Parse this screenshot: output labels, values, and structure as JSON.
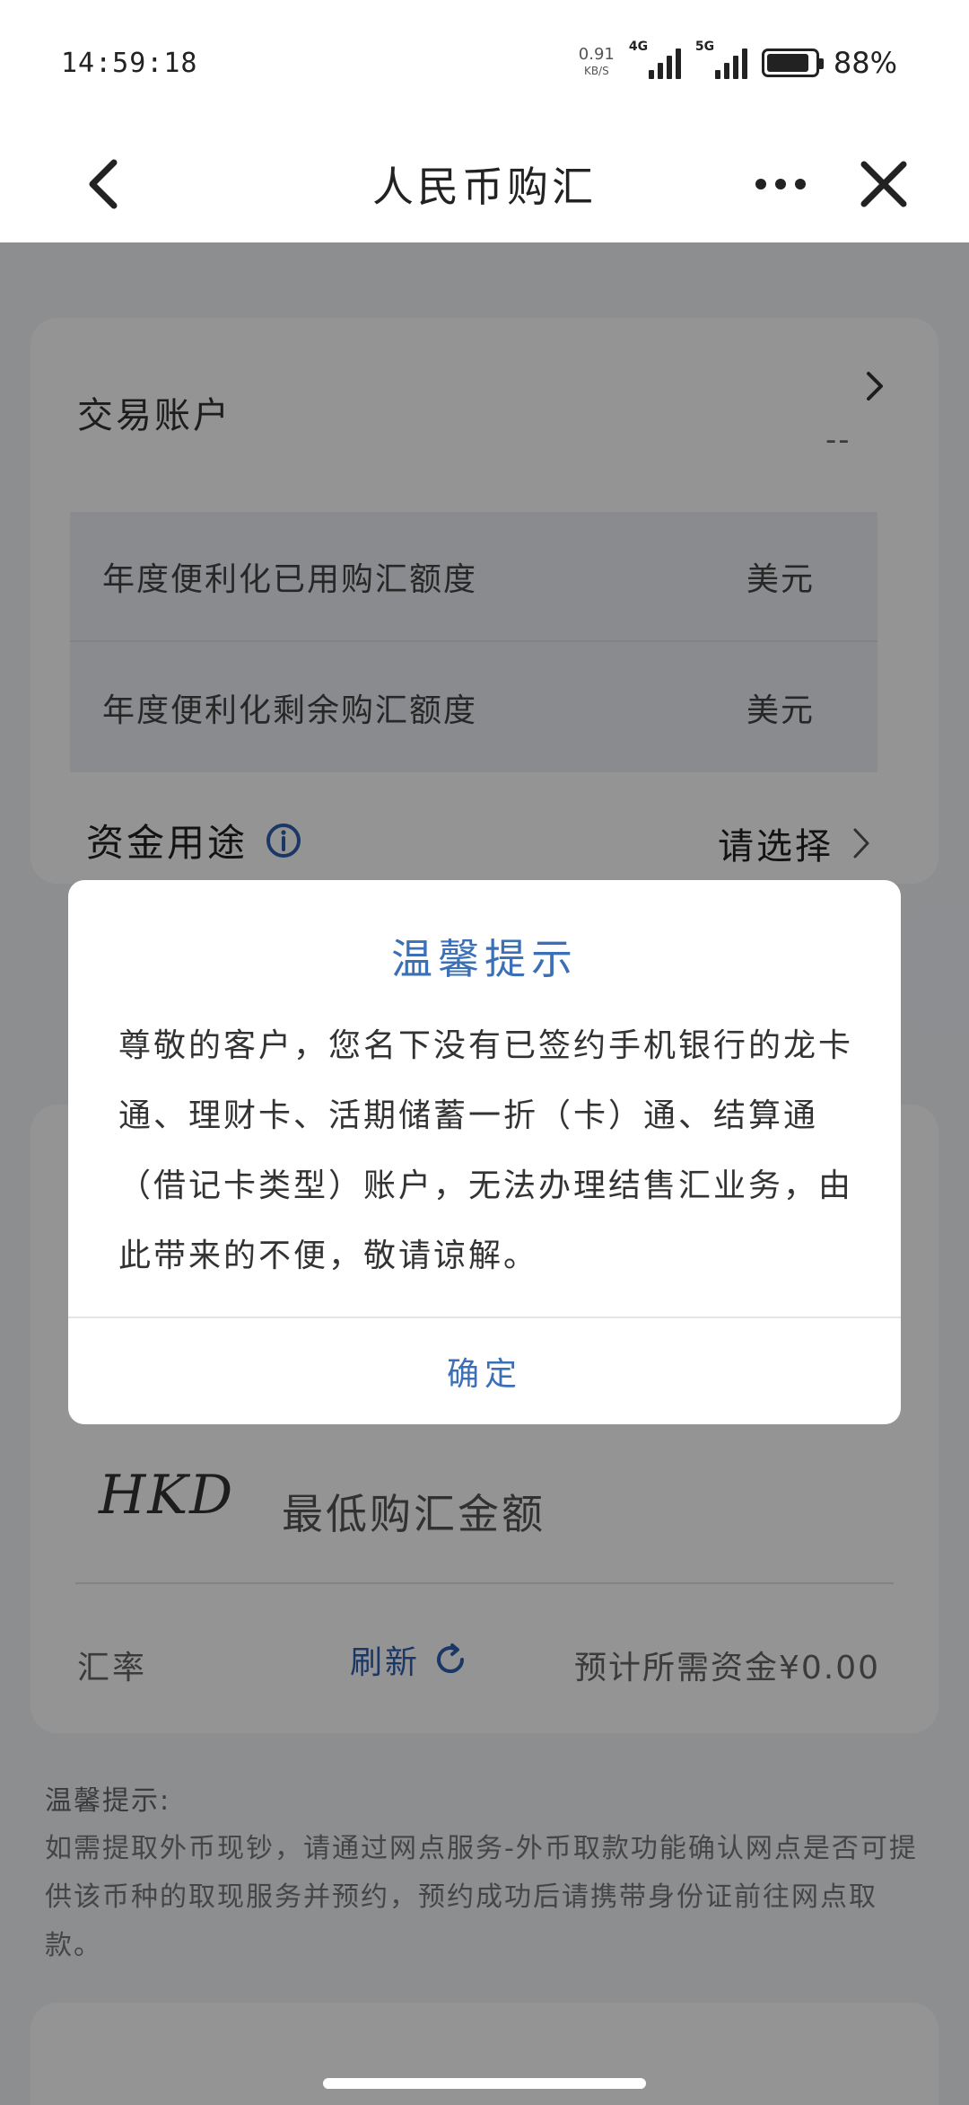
{
  "status_bar": {
    "time": "14:59:18",
    "net_speed": "0.91",
    "net_unit": "KB/S",
    "signal_1": "4G",
    "signal_2": "5G",
    "battery_level": 0.88,
    "battery_text": "88%"
  },
  "nav": {
    "title": "人民币购汇",
    "back_icon": "chevron-left-icon",
    "more_icon": "more-horizontal-icon",
    "close_icon": "close-icon"
  },
  "form": {
    "account_label": "交易账户",
    "account_value": "--",
    "quota_used_label": "年度便利化已用购汇额度",
    "quota_used_unit": "美元",
    "quota_left_label": "年度便利化剩余购汇额度",
    "quota_left_unit": "美元",
    "purpose_label": "资金用途",
    "purpose_placeholder": "请选择",
    "currency_code": "HKD",
    "min_amount_placeholder": "最低购汇金额",
    "rate_label": "汇率",
    "refresh_label": "刷新",
    "expected_funds": "预计所需资金¥0.00"
  },
  "tips": {
    "title": "温馨提示:",
    "body": "如需提取外币现钞，请通过网点服务-外币取款功能确认网点是否可提供该币种的取现服务并预约，预约成功后请携带身份证前往网点取款。"
  },
  "modal": {
    "title": "温馨提示",
    "body": "尊敬的客户，您名下没有已签约手机银行的龙卡通、理财卡、活期储蓄一折（卡）通、结算通（借记卡类型）账户，无法办理结售汇业务，由此带来的不便，敬请谅解。",
    "ok_label": "确定"
  },
  "colors": {
    "accent": "#3b6fb6",
    "overlay": "rgba(0,0,0,0.42)"
  }
}
